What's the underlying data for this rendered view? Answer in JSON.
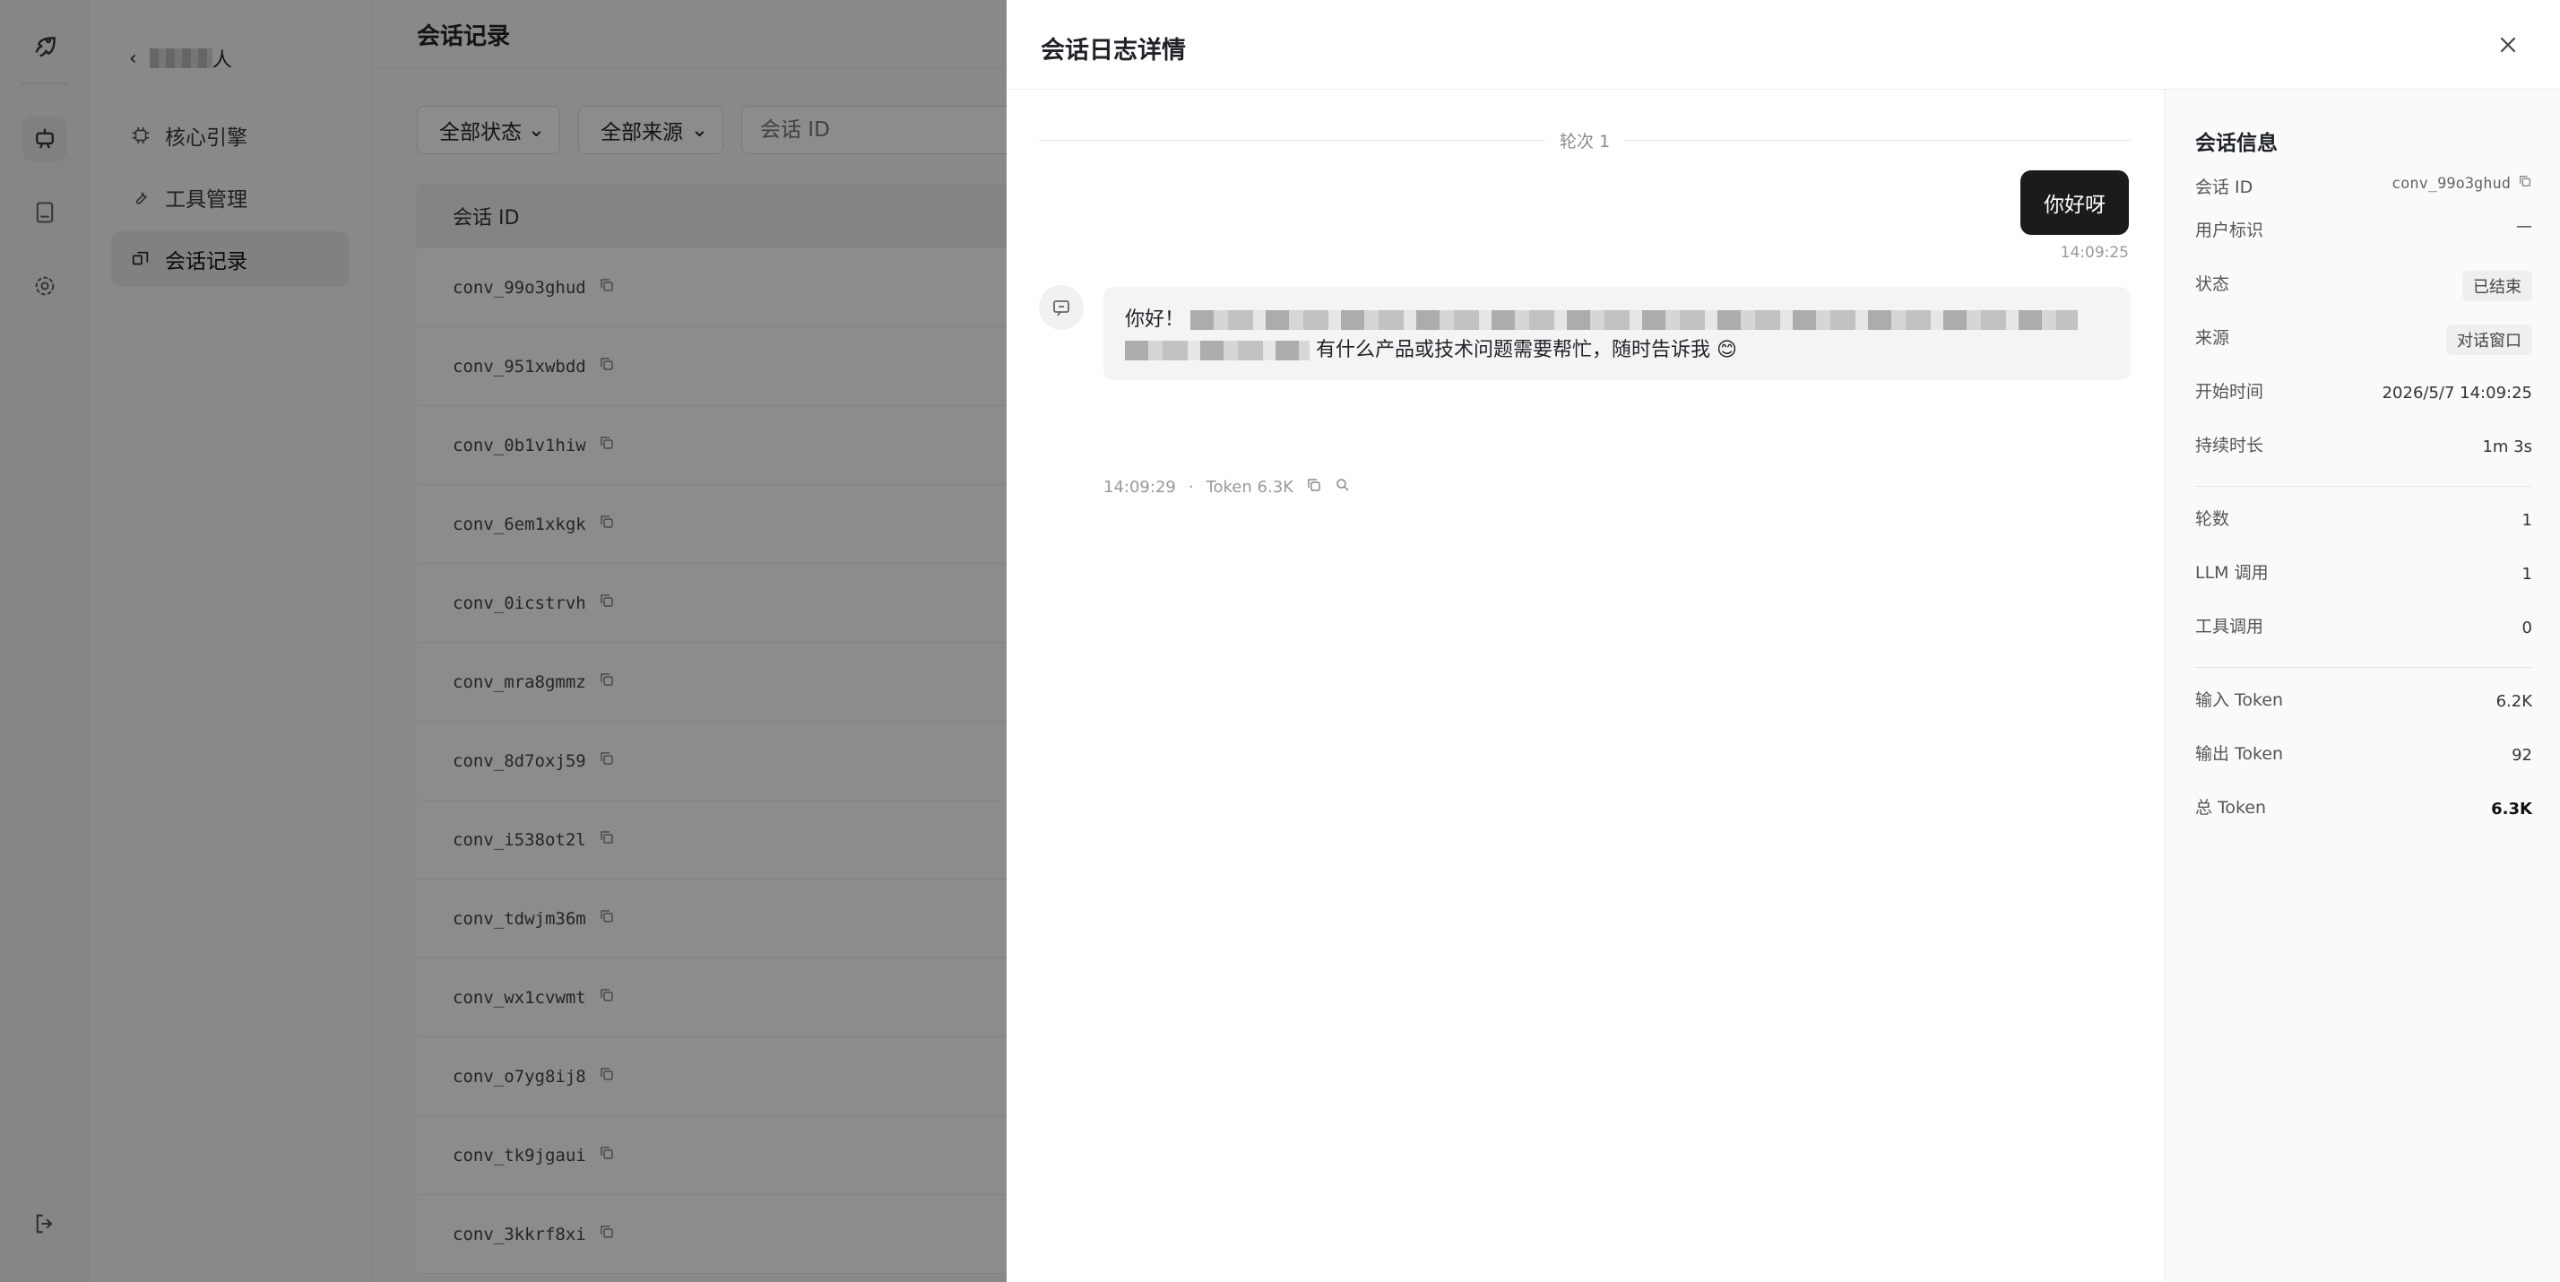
{
  "app": {
    "back_label": "人",
    "nav": [
      {
        "label": "核心引擎",
        "icon": "cpu-icon"
      },
      {
        "label": "工具管理",
        "icon": "wrench-icon"
      },
      {
        "label": "会话记录",
        "icon": "history-icon"
      }
    ],
    "rail_icons": [
      "rocket-icon",
      "robot-icon",
      "book-icon",
      "gear-icon",
      "logout-icon"
    ]
  },
  "main": {
    "title": "会话记录",
    "filters": {
      "status": "全部状态",
      "source": "全部来源",
      "search_placeholder": "会话 ID"
    },
    "table": {
      "header": "会话 ID",
      "rows": [
        "conv_99o3ghud",
        "conv_951xwbdd",
        "conv_0b1v1hiw",
        "conv_6em1xkgk",
        "conv_0icstrvh",
        "conv_mra8gmmz",
        "conv_8d7oxj59",
        "conv_i538ot2l",
        "conv_tdwjm36m",
        "conv_wx1cvwmt",
        "conv_o7yg8ij8",
        "conv_tk9jgaui",
        "conv_3kkrf8xi"
      ]
    }
  },
  "drawer": {
    "title": "会话日志详情",
    "round_label": "轮次 1",
    "user_message": "你好呀",
    "user_time": "14:09:25",
    "bot_message_start": "你好！",
    "bot_message_end": "有什么产品或技术问题需要帮忙，随时告诉我 😊",
    "bot_time": "14:09:29",
    "bot_sep": "·",
    "bot_tokens": "Token 6.3K",
    "info": {
      "title": "会话信息",
      "conversation_id_label": "会话 ID",
      "conversation_id": "conv_99o3ghud",
      "user_label": "用户标识",
      "user": "—",
      "status_label": "状态",
      "status": "已结束",
      "source_label": "来源",
      "source": "对话窗口",
      "start_label": "开始时间",
      "start": "2026/5/7 14:09:25",
      "duration_label": "持续时长",
      "duration": "1m 3s",
      "rounds_label": "轮数",
      "rounds": "1",
      "llm_calls_label": "LLM 调用",
      "llm_calls": "1",
      "tool_calls_label": "工具调用",
      "tool_calls": "0",
      "input_tokens_label": "输入 Token",
      "input_tokens": "6.2K",
      "output_tokens_label": "输出 Token",
      "output_tokens": "92",
      "total_tokens_label": "总 Token",
      "total_tokens": "6.3K"
    }
  }
}
